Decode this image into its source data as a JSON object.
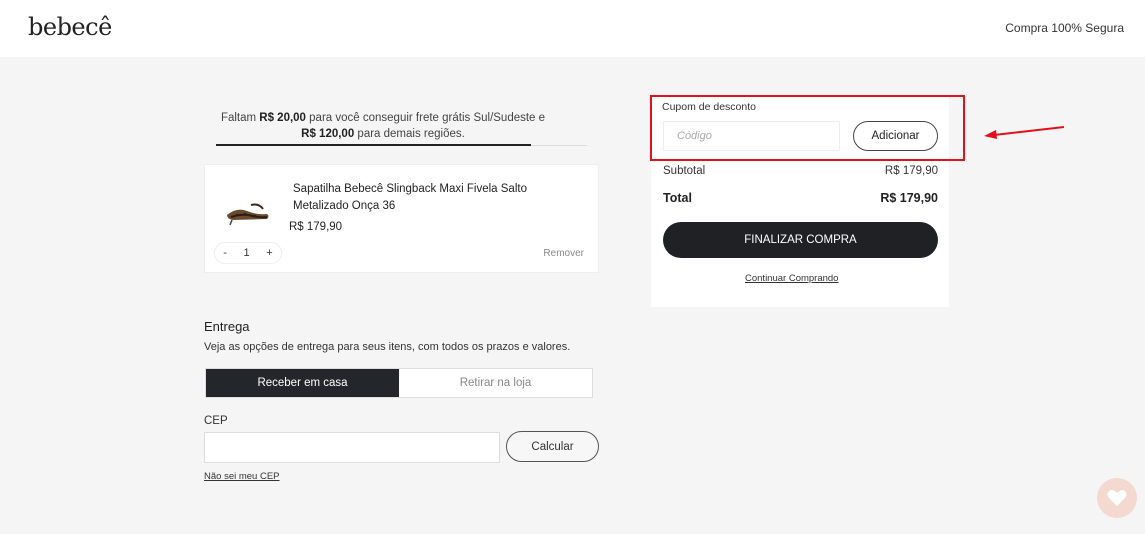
{
  "header": {
    "logo": "bebecê",
    "secure_text": "Compra 100% Segura"
  },
  "free_shipping": {
    "prefix": "Faltam ",
    "amount1": "R$ 20,00",
    "middle": " para você conseguir frete grátis Sul/Sudeste e ",
    "amount2": "R$ 120,00",
    "suffix": " para demais regiões.",
    "progress_fraction": 0.85
  },
  "cart": {
    "items": [
      {
        "name": "Sapatilha Bebecê Slingback Maxi Fivela Salto Metalizado Onça 36",
        "price": "R$ 179,90",
        "quantity": "1",
        "minus": "-",
        "plus": "+",
        "remove_label": "Remover"
      }
    ]
  },
  "delivery": {
    "title": "Entrega",
    "description": "Veja as opções de entrega para seus itens, com todos os prazos e valores.",
    "tabs": [
      {
        "label": "Receber em casa",
        "active": true
      },
      {
        "label": "Retirar na loja",
        "active": false
      }
    ],
    "cep_label": "CEP",
    "cep_value": "",
    "calculate_label": "Calcular",
    "unknown_cep_link": "Não sei meu CEP"
  },
  "summary": {
    "coupon_label": "Cupom de desconto",
    "coupon_placeholder": "Código",
    "coupon_button": "Adicionar",
    "subtotal_label": "Subtotal",
    "subtotal_value": "R$ 179,90",
    "total_label": "Total",
    "total_value": "R$ 179,90",
    "checkout_button": "FINALIZAR COMPRA",
    "continue_link": "Continuar Comprando"
  },
  "colors": {
    "highlight": "#e3101b",
    "dark_button": "#1f2125",
    "chat_bubble": "#f3d9cf"
  }
}
